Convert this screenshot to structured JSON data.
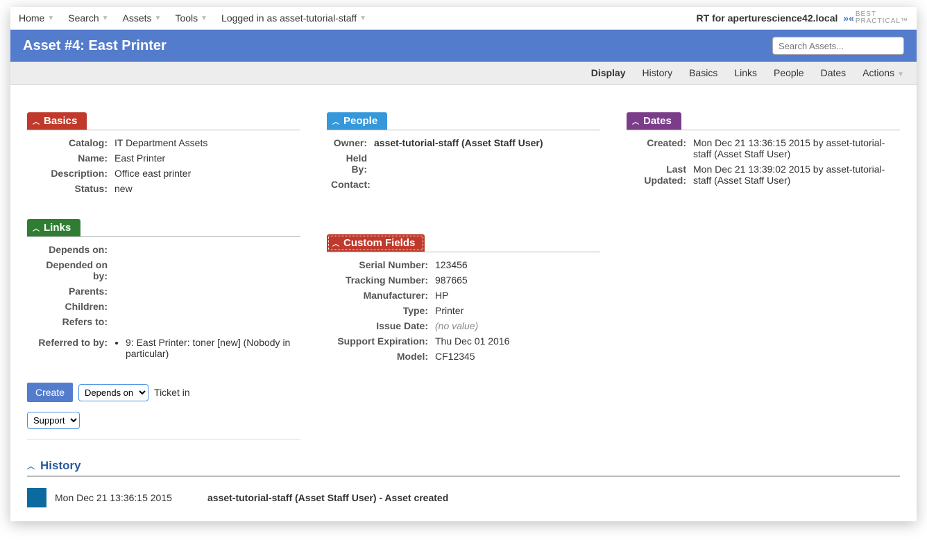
{
  "topnav": {
    "items": [
      "Home",
      "Search",
      "Assets",
      "Tools"
    ],
    "logged_in": "Logged in as asset-tutorial-staff",
    "rt_for": "RT for aperturescience42.local",
    "bp_line1": "BEST",
    "bp_line2": "PRACTICAL™"
  },
  "titlebar": {
    "title": "Asset #4: East Printer",
    "search_placeholder": "Search Assets..."
  },
  "tabs": {
    "items": [
      "Display",
      "History",
      "Basics",
      "Links",
      "People",
      "Dates",
      "Actions"
    ],
    "active": "Display"
  },
  "basics": {
    "title": "Basics",
    "fields": {
      "catalog_label": "Catalog:",
      "catalog": "IT Department Assets",
      "name_label": "Name:",
      "name": "East Printer",
      "description_label": "Description:",
      "description": "Office east printer",
      "status_label": "Status:",
      "status": "new"
    }
  },
  "people": {
    "title": "People",
    "owner_label": "Owner:",
    "owner": "asset-tutorial-staff (Asset Staff User)",
    "heldby_label": "Held By:",
    "heldby": "",
    "contact_label": "Contact:",
    "contact": ""
  },
  "dates": {
    "title": "Dates",
    "created_label": "Created:",
    "created": "Mon Dec 21 13:36:15 2015 by asset-tutorial-staff (Asset Staff User)",
    "updated_label": "Last Updated:",
    "updated": "Mon Dec 21 13:39:02 2015 by asset-tutorial-staff (Asset Staff User)"
  },
  "links": {
    "title": "Links",
    "depends_on_label": "Depends on:",
    "depended_on_by_label": "Depended on by:",
    "parents_label": "Parents:",
    "children_label": "Children:",
    "refers_to_label": "Refers to:",
    "referred_to_by_label": "Referred to by:",
    "referred_item": "9: East Printer: toner [new] (Nobody in particular)",
    "create_btn": "Create",
    "link_dir": "Depends on",
    "ticket_in": "Ticket in",
    "queue": "Support"
  },
  "custom_fields": {
    "title": "Custom Fields",
    "serial_label": "Serial Number:",
    "serial": "123456",
    "tracking_label": "Tracking Number:",
    "tracking": "987665",
    "manufacturer_label": "Manufacturer:",
    "manufacturer": "HP",
    "type_label": "Type:",
    "type": "Printer",
    "issue_label": "Issue Date:",
    "issue": "(no value)",
    "support_label": "Support Expiration:",
    "support": "Thu Dec 01 2016",
    "model_label": "Model:",
    "model": "CF12345"
  },
  "history": {
    "title": "History",
    "entries": [
      {
        "time": "Mon Dec 21 13:36:15 2015",
        "desc": "asset-tutorial-staff (Asset Staff User) - Asset created"
      }
    ]
  }
}
